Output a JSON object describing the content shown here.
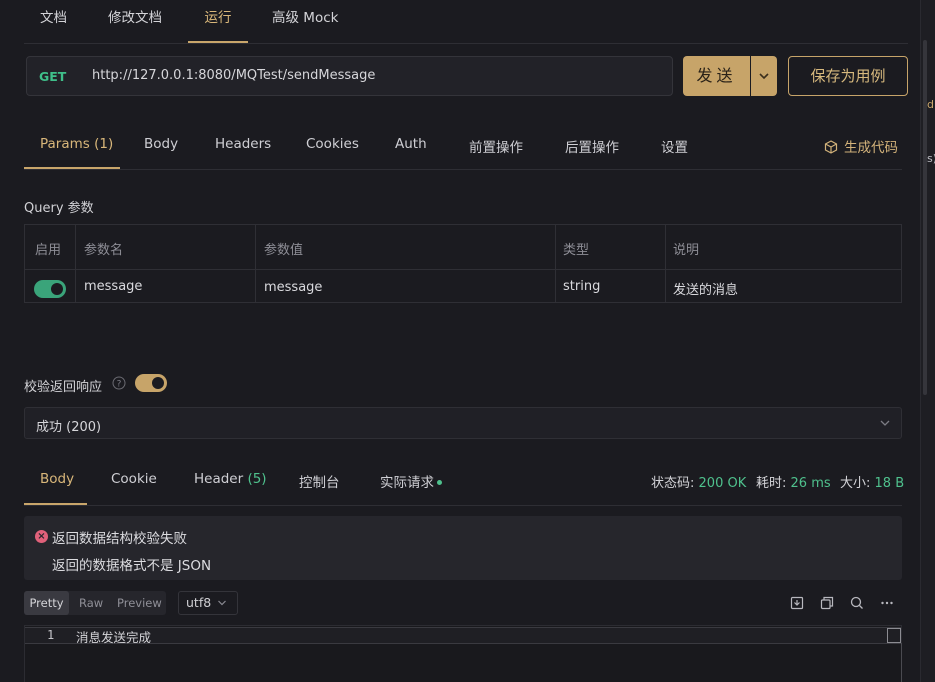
{
  "top_tabs": [
    {
      "label": "文档",
      "active": false
    },
    {
      "label": "修改文档",
      "active": false
    },
    {
      "label": "运行",
      "active": true
    },
    {
      "label": "高级 Mock",
      "active": false
    }
  ],
  "gutter_fragments": [
    "d",
    "s)"
  ],
  "request": {
    "method": "GET",
    "url": "http://127.0.0.1:8080/MQTest/sendMessage",
    "send_label": "发送",
    "save_label": "保存为用例"
  },
  "request_tabs": [
    {
      "label": "Params",
      "count": "(1)",
      "active": true
    },
    {
      "label": "Body",
      "count": "",
      "active": false
    },
    {
      "label": "Headers",
      "count": "",
      "active": false
    },
    {
      "label": "Cookies",
      "count": "",
      "active": false
    },
    {
      "label": "Auth",
      "count": "",
      "active": false
    },
    {
      "label": "前置操作",
      "count": "",
      "active": false
    },
    {
      "label": "后置操作",
      "count": "",
      "active": false
    },
    {
      "label": "设置",
      "count": "",
      "active": false
    }
  ],
  "generate_code_label": "生成代码",
  "query": {
    "section_label": "Query 参数",
    "columns": [
      "启用",
      "参数名",
      "参数值",
      "类型",
      "说明"
    ],
    "rows": [
      {
        "enabled": true,
        "name": "message",
        "value": "message",
        "type": "string",
        "description": "发送的消息"
      }
    ]
  },
  "validate": {
    "label": "校验返回响应",
    "enabled": true,
    "selected_response": "成功 (200)"
  },
  "response_tabs": [
    {
      "label": "Body",
      "count": "",
      "active": true
    },
    {
      "label": "Cookie",
      "count": "",
      "active": false
    },
    {
      "label": "Header",
      "count": "(5)",
      "active": false
    },
    {
      "label": "控制台",
      "count": "",
      "active": false
    },
    {
      "label": "实际请求",
      "count": "",
      "active": false
    }
  ],
  "status": {
    "code_label": "状态码:",
    "code_value": "200 OK",
    "time_label": "耗时:",
    "time_value": "26 ms",
    "size_label": "大小:",
    "size_value": "18 B"
  },
  "error": {
    "title": "返回数据结构校验失败",
    "message": "返回的数据格式不是 JSON"
  },
  "format": {
    "modes": [
      "Pretty",
      "Raw",
      "Preview"
    ],
    "active_mode": "Pretty",
    "encoding": "utf8"
  },
  "body": {
    "lines": [
      {
        "number": "1",
        "text": "消息发送完成"
      }
    ]
  },
  "colors": {
    "accent": "#c7a469",
    "success": "#3fbf8a",
    "error": "#e0617a",
    "background": "#1b1b20"
  }
}
